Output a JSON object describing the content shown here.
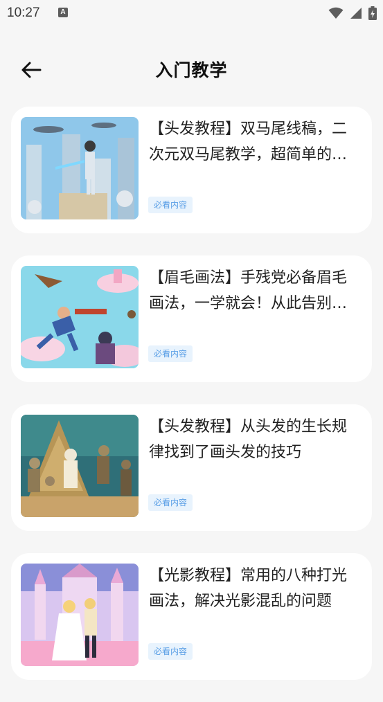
{
  "status_bar": {
    "time": "10:27",
    "notification_letter": "A",
    "icons": [
      "wifi-icon",
      "signal-icon",
      "battery-charging-icon"
    ]
  },
  "header": {
    "title": "入门教学",
    "back_icon": "arrow-left-icon"
  },
  "articles": [
    {
      "title": "【头发教程】双马尾线稿，二次元双马尾教学，超简单的画法分享",
      "tag": "必看内容",
      "thumb": "sci-fi city with robots"
    },
    {
      "title": "【眉毛画法】手残党必备眉毛画法，一学就会！从此告别画不好",
      "tag": "必看内容",
      "thumb": "flying hero with blaster"
    },
    {
      "title": "【头发教程】从头发的生长规律找到了画头发的技巧",
      "tag": "必看内容",
      "thumb": "mummies near pyramid"
    },
    {
      "title": "【光影教程】常用的八种打光画法，解决光影混乱的问题",
      "tag": "必看内容",
      "thumb": "couple in pink castle"
    }
  ],
  "colors": {
    "background": "#f6f6f6",
    "card": "#ffffff",
    "tag_text": "#5a9fe6",
    "tag_bg": "#e8f3fd"
  }
}
